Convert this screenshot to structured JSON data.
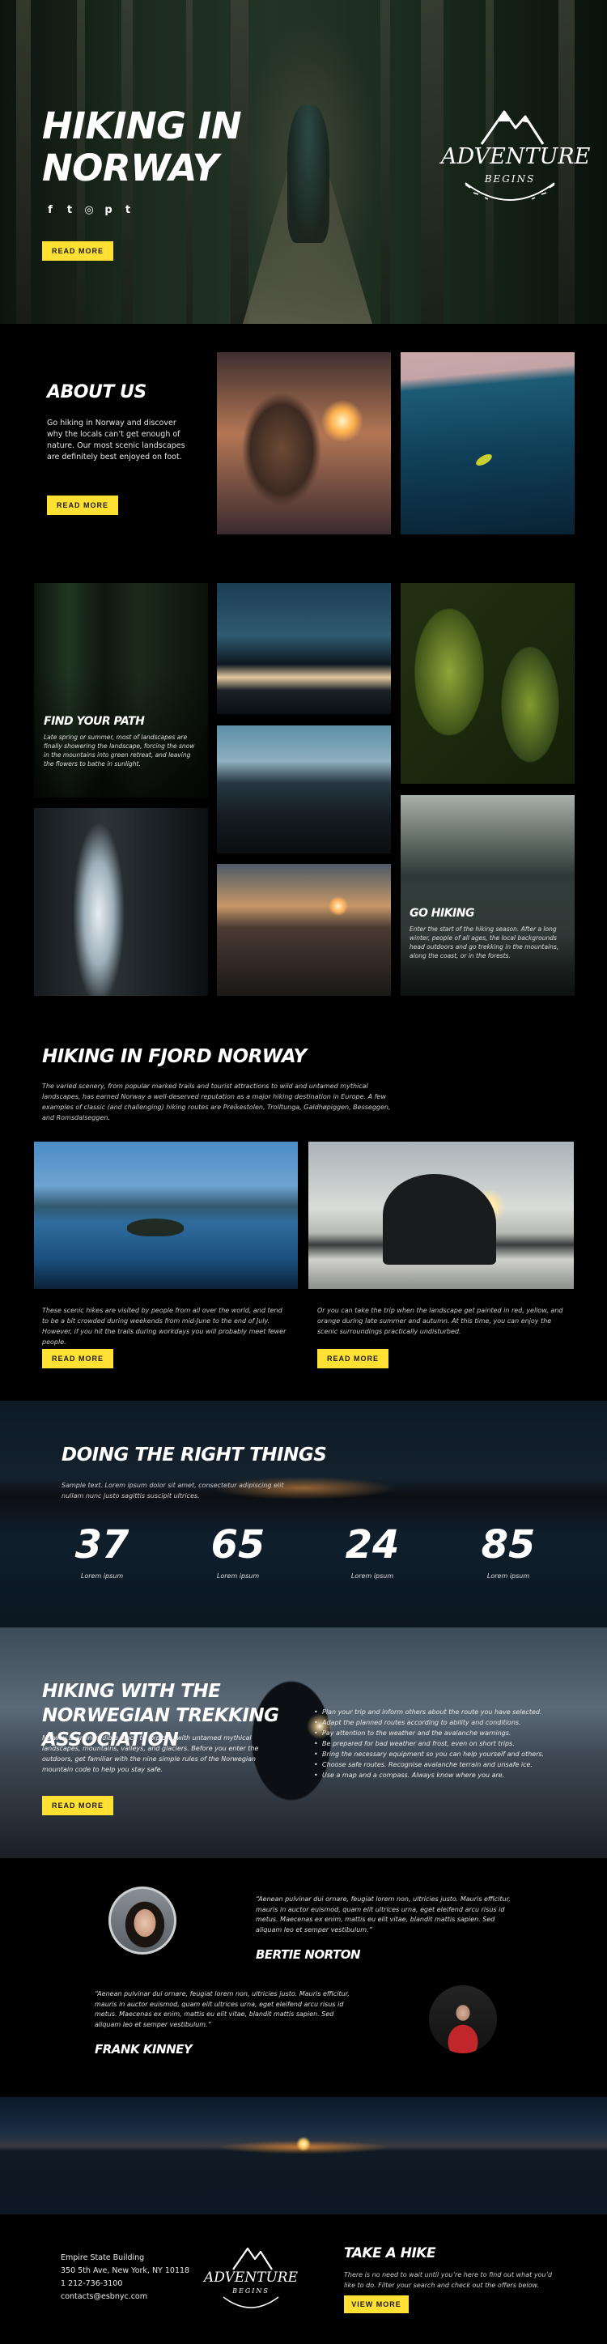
{
  "hero": {
    "title": "HIKING IN NORWAY",
    "socials": [
      "f",
      "t",
      "◎",
      "p",
      "t"
    ],
    "button": "READ MORE",
    "logo": {
      "word": "ADVENTURE",
      "sub": "BEGINS"
    }
  },
  "about": {
    "title": "ABOUT US",
    "text": "Go hiking in Norway and discover why the locals can’t get enough of nature. Our most scenic landscapes are definitely best enjoyed on foot.",
    "button": "READ MORE"
  },
  "gallery": {
    "find": {
      "title": "FIND YOUR PATH",
      "text": "Late spring or summer, most of landscapes are finally showering the landscape, forcing the snow in the mountains into green retreat, and leaving the flowers to bathe in sunlight."
    },
    "go": {
      "title": "GO HIKING",
      "text": "Enter the start of the hiking season. After a long winter, people of all ages, the local backgrounds head outdoors and go trekking in the mountains, along the coast, or in the forests."
    }
  },
  "fjord": {
    "title": "HIKING IN FJORD NORWAY",
    "intro": "The varied scenery, from popular marked trails and tourist attractions to wild and untamed mythical landscapes, has earned Norway a well-deserved reputation as a major hiking destination in Europe. A few examples of classic (and challenging) hiking routes are Preikestolen, Trolltunga, Galdhøpiggen, Besseggen, and Romsdalseggen.",
    "col1": "These scenic hikes are visited by people from all over the world, and tend to be a bit crowded during weekends from mid-June to the end of July. However, if you hit the trails during workdays you will probably meet fewer people.",
    "col2": "Or you can take the trip when the landscape get painted in red, yellow, and orange during late summer and autumn. At this time, you can enjoy the scenic surroundings practically undisturbed.",
    "button1": "READ MORE",
    "button2": "READ MORE"
  },
  "stats": {
    "title": "DOING THE RIGHT THINGS",
    "intro": "Sample text. Lorem ipsum dolor sit amet, consectetur adipiscing elit nullam nunc justo sagittis suscipit ultrices.",
    "items": [
      {
        "num": "37",
        "label": "Lorem ipsum"
      },
      {
        "num": "65",
        "label": "Lorem ipsum"
      },
      {
        "num": "24",
        "label": "Lorem ipsum"
      },
      {
        "num": "85",
        "label": "Lorem ipsum"
      }
    ]
  },
  "nta": {
    "title": "HIKING WITH THE NORWEGIAN TREKKING ASSOCIATION",
    "intro": "Norway is an incredible place to explore, with untamed mythical landscapes, mountains, valleys, and glaciers. Before you enter the outdoors, get familiar with the nine simple rules of the Norwegian mountain code to help you stay safe.",
    "list": [
      "Plan your trip and inform others about the route you have selected.",
      "Adapt the planned routes according to ability and conditions.",
      "Pay attention to the weather and the avalanche warnings.",
      "Be prepared for bad weather and frost, even on short trips.",
      "Bring the necessary equipment so you can help yourself and others.",
      "Choose safe routes. Recognise avalanche terrain and unsafe ice.",
      "Use a map and a compass. Always know where you are."
    ],
    "button": "READ MORE"
  },
  "testimonials": [
    {
      "quote": "“Aenean pulvinar dui ornare, feugiat lorem non, ultricies justo. Mauris efficitur, mauris in auctor euismod, quam elit ultrices urna, eget eleifend arcu risus id metus. Maecenas ex enim, mattis eu elit vitae, blandit mattis sapien. Sed aliquam leo et semper vestibulum.”",
      "author": "BERTIE NORTON"
    },
    {
      "quote": "“Aenean pulvinar dui ornare, feugiat lorem non, ultricies justo. Mauris efficitur, mauris in auctor euismod, quam elit ultrices urna, eget eleifend arcu risus id metus. Maecenas ex enim, mattis eu elit vitae, blandit mattis sapien. Sed aliquam leo et semper vestibulum.”",
      "author": "FRANK KINNEY"
    }
  ],
  "footer": {
    "address": [
      "Empire State Building",
      "350 5th Ave, New York, NY 10118",
      "1 212-736-3100",
      "contacts@esbnyc.com"
    ],
    "logo": {
      "word": "ADVENTURE",
      "sub": "BEGINS"
    },
    "title": "TAKE A HIKE",
    "text": "There is no need to wait until you’re here to find out what you’d like to do. Filter your search and check out the offers below.",
    "button": "VIEW MORE"
  },
  "colors": {
    "accent": "#ffe033",
    "background": "#000000"
  }
}
